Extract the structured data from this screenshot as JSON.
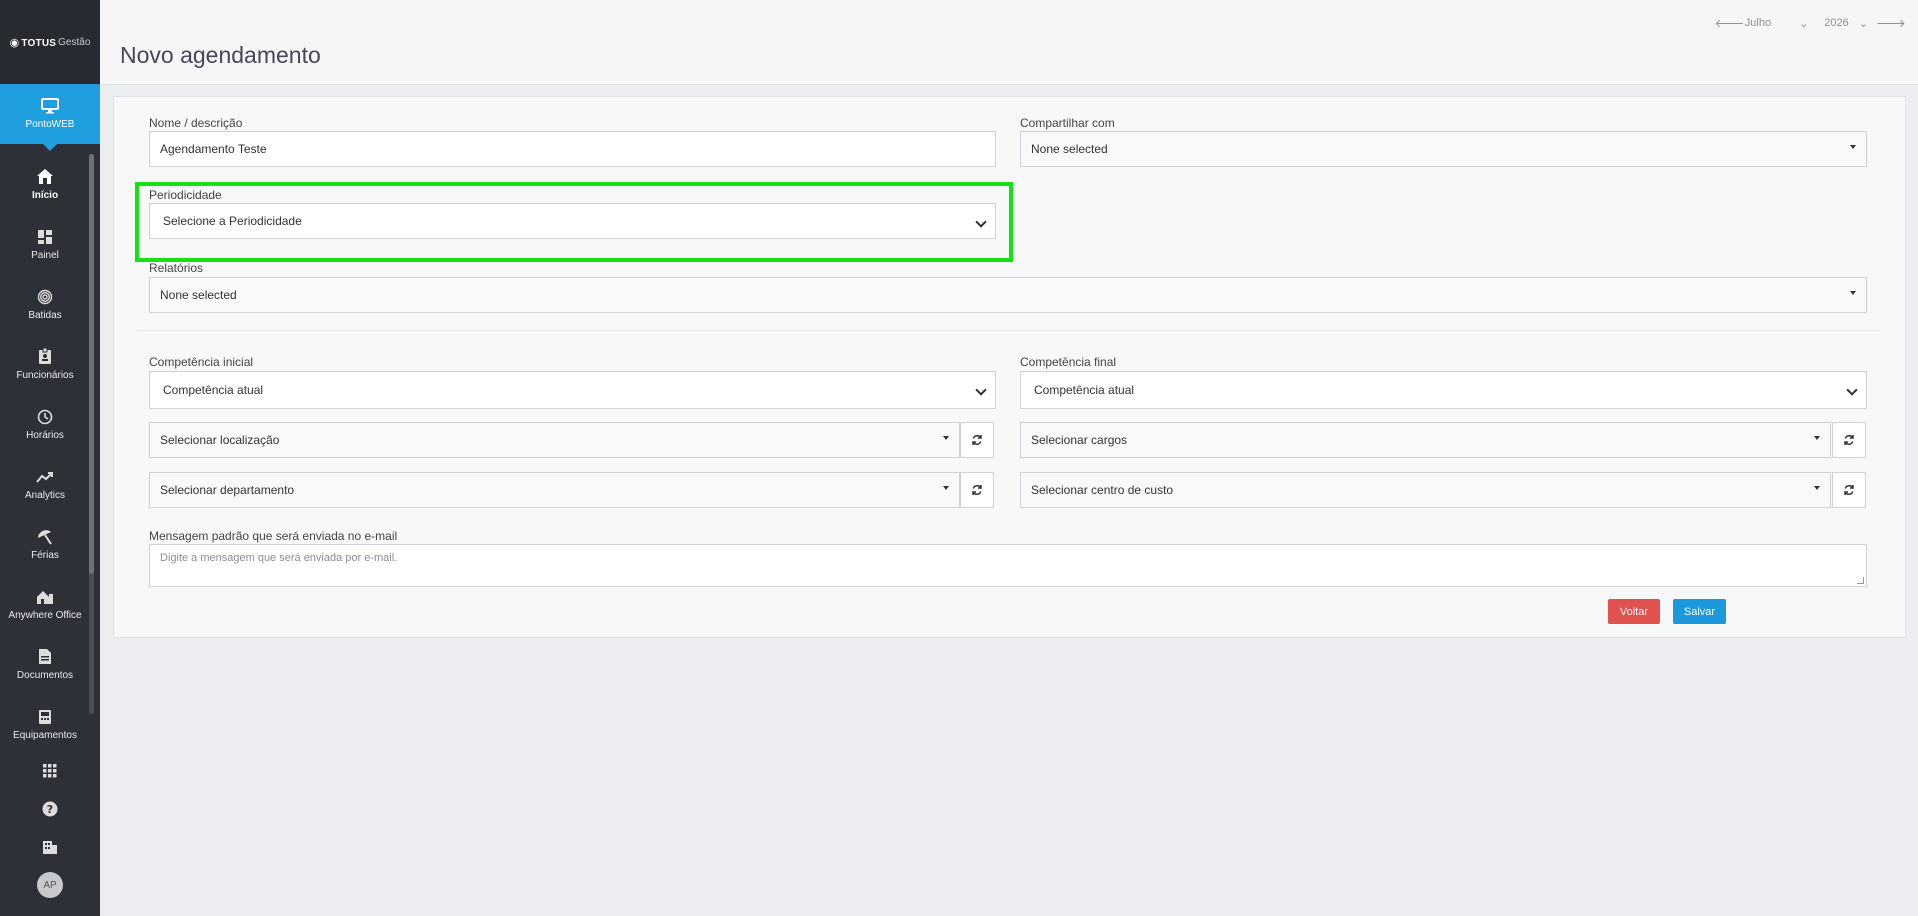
{
  "brand": {
    "name": "TOTUS",
    "sub": "Gestão"
  },
  "product": {
    "name": "PontoWEB"
  },
  "sidebar": {
    "items": [
      {
        "label": "Início",
        "icon": "home-icon"
      },
      {
        "label": "Painel",
        "icon": "dashboard-icon"
      },
      {
        "label": "Batidas",
        "icon": "fingerprint-icon"
      },
      {
        "label": "Funcionários",
        "icon": "badge-icon"
      },
      {
        "label": "Horários",
        "icon": "clock-icon"
      },
      {
        "label": "Analytics",
        "icon": "trend-icon"
      },
      {
        "label": "Férias",
        "icon": "umbrella-icon"
      },
      {
        "label": "Anywhere Office",
        "icon": "building-icon"
      },
      {
        "label": "Documentos",
        "icon": "document-icon"
      },
      {
        "label": "Equipamentos",
        "icon": "device-icon"
      }
    ],
    "avatar": "AP"
  },
  "header": {
    "title": "Novo agendamento",
    "month": "Julho",
    "year": "2026"
  },
  "form": {
    "nome_label": "Nome / descrição",
    "nome_value": "Agendamento Teste",
    "compartilhar_label": "Compartilhar com",
    "compartilhar_value": "None selected",
    "periodicidade_label": "Periodicidade",
    "periodicidade_value": "Selecione a Periodicidade",
    "relatorios_label": "Relatórios",
    "relatorios_value": "None selected",
    "comp_inicial_label": "Competência inicial",
    "comp_inicial_value": "Competência atual",
    "comp_final_label": "Competência final",
    "comp_final_value": "Competência atual",
    "localizacao": "Selecionar localização",
    "cargos": "Selecionar cargos",
    "departamento": "Selecionar departamento",
    "centro_custo": "Selecionar centro de custo",
    "mensagem_label": "Mensagem padrão que será enviada no e-mail",
    "mensagem_placeholder": "Digite a mensagem que será enviada por e-mail."
  },
  "actions": {
    "back": "Voltar",
    "save": "Salvar"
  },
  "colors": {
    "accent": "#1f9fe0",
    "danger": "#e0524e",
    "highlight": "#18e018",
    "sidebar": "#2d3036"
  }
}
